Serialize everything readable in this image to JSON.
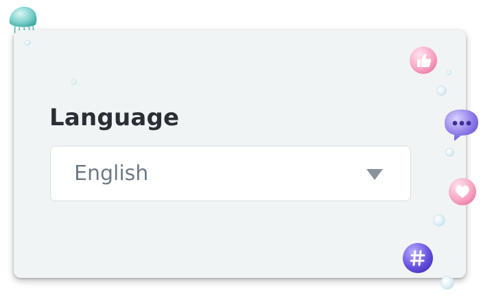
{
  "language": {
    "label": "Language",
    "selected_value": "English"
  },
  "decorations": {
    "icons": [
      "jellyfish-teal-icon",
      "jellyfish-purple-icon",
      "thumbs-up-bubble-icon",
      "chat-bubble-icon",
      "heart-bubble-icon",
      "hashtag-bubble-icon"
    ]
  },
  "colors": {
    "card_background": "#f1f4f5",
    "label_text": "#2a2f35",
    "select_text": "#6e7a85",
    "chevron": "#8a939b"
  }
}
